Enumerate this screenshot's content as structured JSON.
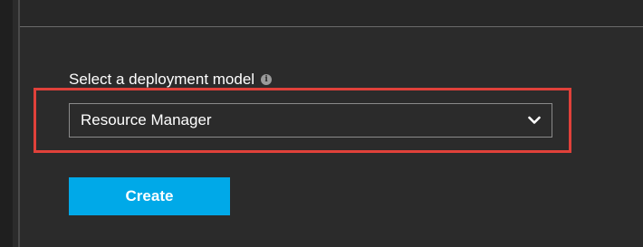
{
  "form": {
    "label": "Select a deployment model",
    "info_icon": "info-icon",
    "select": {
      "value": "Resource Manager",
      "icon": "chevron-down-icon"
    },
    "create_label": "Create"
  },
  "colors": {
    "background": "#2b2b2b",
    "accent_button": "#00a9e8",
    "highlight_box": "#e0413a",
    "text": "#ffffff"
  }
}
